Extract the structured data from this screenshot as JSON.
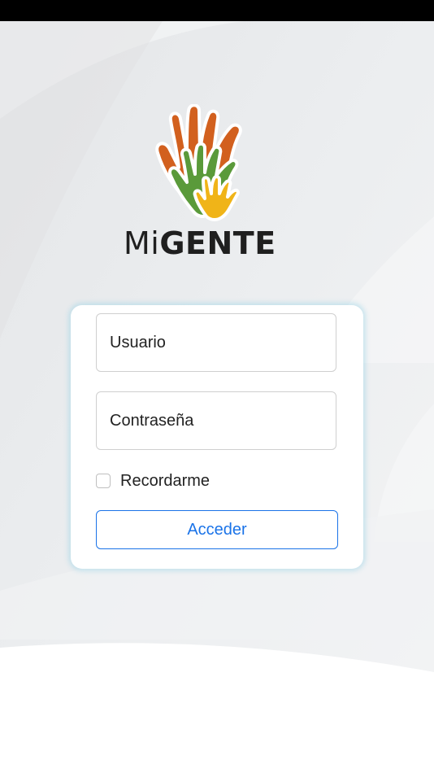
{
  "app": {
    "brand_prefix": "Mi",
    "brand_name": "GENTE"
  },
  "login": {
    "username_placeholder": "Usuario",
    "password_placeholder": "Contraseña",
    "remember_label": "Recordarme",
    "submit_label": "Acceder"
  },
  "colors": {
    "hand_orange": "#d2601e",
    "hand_green": "#5a9a3a",
    "hand_yellow": "#f0b418",
    "accent_blue": "#1a73e8",
    "status_bar": "#000000"
  }
}
